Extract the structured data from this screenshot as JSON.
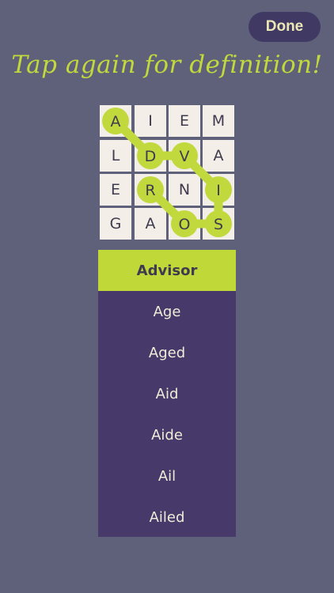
{
  "header": {
    "done_label": "Done",
    "hint": "Tap again for definition!"
  },
  "grid": {
    "rows": [
      [
        "A",
        "I",
        "E",
        "M"
      ],
      [
        "L",
        "D",
        "V",
        "A"
      ],
      [
        "E",
        "R",
        "N",
        "I"
      ],
      [
        "G",
        "A",
        "O",
        "S"
      ]
    ],
    "path": [
      [
        0,
        0
      ],
      [
        1,
        1
      ],
      [
        1,
        2
      ],
      [
        2,
        3
      ],
      [
        3,
        3
      ],
      [
        3,
        2
      ],
      [
        2,
        1
      ]
    ],
    "path_color": "#c1d93c",
    "cell_color": "#f3eee8",
    "letter_color": "#3f3b4f"
  },
  "words": {
    "selected": "Advisor",
    "items": [
      "Age",
      "Aged",
      "Aid",
      "Aide",
      "Ail",
      "Ailed"
    ]
  },
  "colors": {
    "background": "#5f6079",
    "panel": "#47396a",
    "accent": "#c1d93c"
  }
}
